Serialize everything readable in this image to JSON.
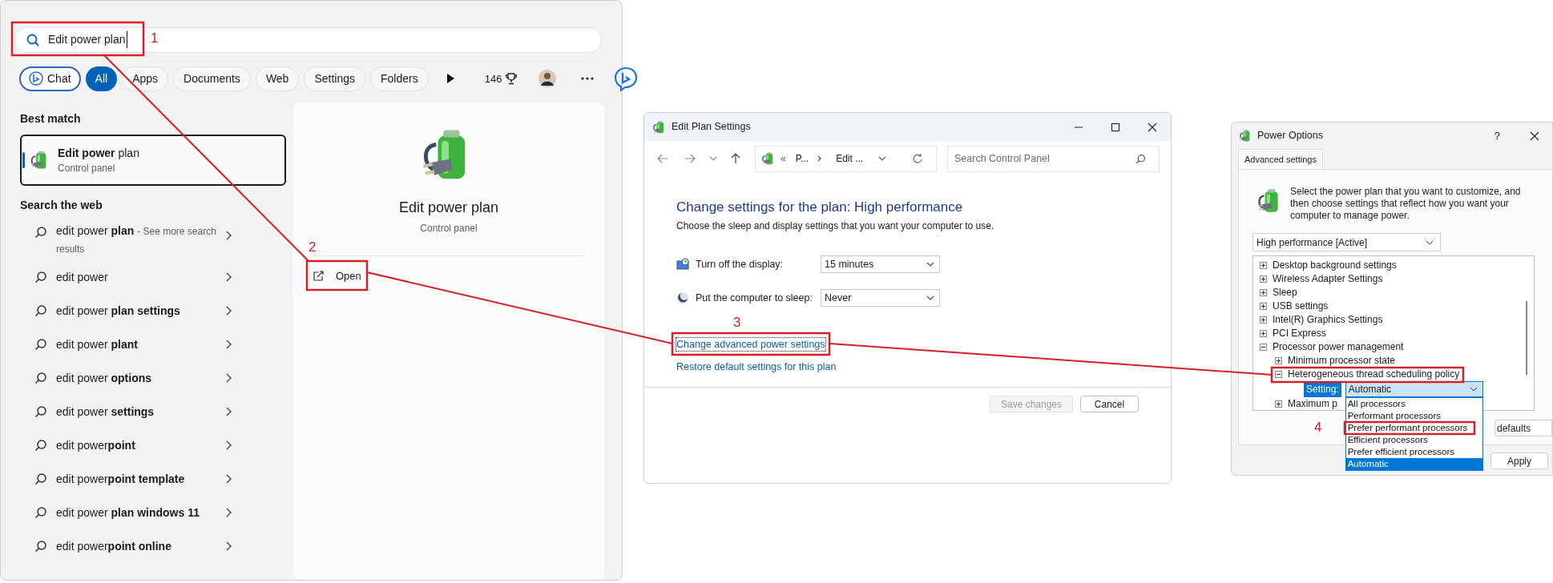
{
  "search_panel": {
    "query": "Edit power plan",
    "filters": [
      {
        "label": "Chat",
        "kind": "chat",
        "selected": false
      },
      {
        "label": "All",
        "kind": "chip",
        "selected": true
      },
      {
        "label": "Apps",
        "kind": "chip",
        "selected": false
      },
      {
        "label": "Documents",
        "kind": "chip",
        "selected": false
      },
      {
        "label": "Web",
        "kind": "chip",
        "selected": false
      },
      {
        "label": "Settings",
        "kind": "chip",
        "selected": false
      },
      {
        "label": "Folders",
        "kind": "chip",
        "selected": false
      }
    ],
    "points": "146",
    "best_match_heading": "Best match",
    "best_match": {
      "title": "**Edit power** plan",
      "subtitle": "Control panel",
      "selected": true
    },
    "web_heading": "Search the web",
    "web_results": [
      {
        "text": "edit power **plan**",
        "note": "- See more search results"
      },
      {
        "text": "edit power"
      },
      {
        "text": "edit power **plan settings**"
      },
      {
        "text": "edit power **plant**"
      },
      {
        "text": "edit power **options**"
      },
      {
        "text": "edit power **settings**"
      },
      {
        "text": "edit power**point**"
      },
      {
        "text": "edit power**point template**"
      },
      {
        "text": "edit power **plan windows 11**"
      },
      {
        "text": "edit power**point online**"
      }
    ],
    "preview": {
      "title": "Edit power plan",
      "subtitle": "Control panel",
      "actions": [
        {
          "label": "Open"
        }
      ]
    }
  },
  "edit_plan_window": {
    "title": "Edit Plan Settings",
    "address": {
      "overflow": "«",
      "crumbs": [
        "P...",
        "Edit ..."
      ]
    },
    "search_placeholder": "Search Control Panel",
    "heading": "Change settings for the plan: High performance",
    "description": "Choose the sleep and display settings that you want your computer to use.",
    "settings": [
      {
        "kind": "display",
        "label": "Turn off the display:",
        "value": "15 minutes"
      },
      {
        "kind": "sleep",
        "label": "Put the computer to sleep:",
        "value": "Never"
      }
    ],
    "links": [
      {
        "label": "Change advanced power settings",
        "focused": true
      },
      {
        "label": "Restore default settings for this plan",
        "focused": false
      }
    ],
    "buttons": [
      {
        "label": "Save changes",
        "disabled": true
      },
      {
        "label": "Cancel",
        "disabled": false
      }
    ]
  },
  "power_options_window": {
    "title": "Power Options",
    "help": "?",
    "tabs": [
      {
        "label": "Advanced settings",
        "selected": true
      }
    ],
    "description": "Select the power plan that you want to customize, and then choose settings that reflect how you want your computer to manage power.",
    "plan": "High performance [Active]",
    "tree": [
      {
        "label": "Desktop background settings",
        "expanded": false
      },
      {
        "label": "Wireless Adapter Settings",
        "expanded": false
      },
      {
        "label": "Sleep",
        "expanded": false
      },
      {
        "label": "USB settings",
        "expanded": false
      },
      {
        "label": "Intel(R) Graphics Settings",
        "expanded": false
      },
      {
        "label": "PCI Express",
        "expanded": false
      },
      {
        "label": "Processor power management",
        "expanded": true,
        "children": [
          {
            "label": "Minimum processor state",
            "expanded": false
          },
          {
            "label": "Heterogeneous thread scheduling policy",
            "expanded": true,
            "setting": {
              "label": "Setting:",
              "value": "Automatic",
              "open": true,
              "options": [
                {
                  "label": "All processors",
                  "selected": false
                },
                {
                  "label": "Performant processors",
                  "selected": false
                },
                {
                  "label": "Prefer performant processors",
                  "selected": false
                },
                {
                  "label": "Efficient processors",
                  "selected": false
                },
                {
                  "label": "Prefer efficient processors",
                  "selected": false
                },
                {
                  "label": "Automatic",
                  "selected": true
                }
              ]
            }
          },
          {
            "label": "Maximum p",
            "expanded": false
          }
        ]
      }
    ],
    "buttons": [
      {
        "label": "defaults"
      },
      {
        "label": "Apply"
      }
    ]
  },
  "annotations": [
    {
      "label": "1"
    },
    {
      "label": "2"
    },
    {
      "label": "3"
    },
    {
      "label": "4"
    }
  ]
}
